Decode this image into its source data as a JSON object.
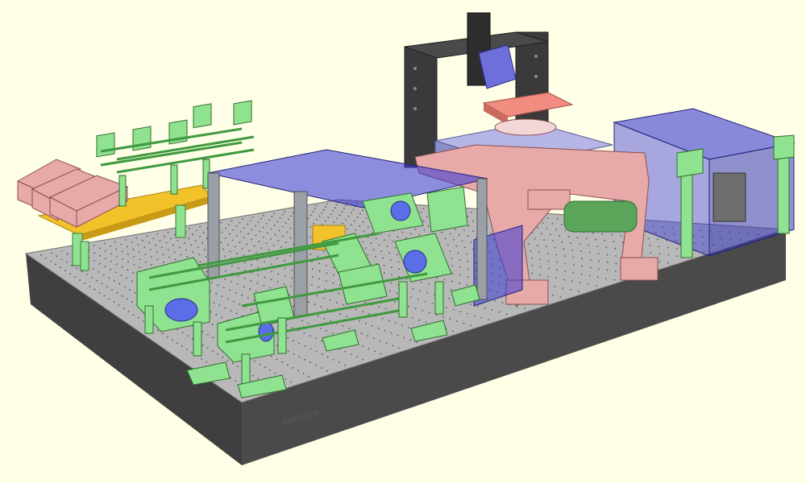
{
  "viewport": {
    "background": "#fffee6"
  },
  "colors": {
    "table_top": "#b4b4b4",
    "table_side": "#474747",
    "table_hole": "#555555",
    "mount_green": "#8fe28f",
    "mount_green_dark": "#4c9a4c",
    "enclosure_blue": "#3b3bd6",
    "enclosure_blue_alpha": "0.55",
    "frame_gray": "#9aa0a6",
    "bracket_dark": "#3a3a3a",
    "pink_part": "#e8a9a9",
    "pink_dark": "#b76f6f",
    "yellow_rail": "#f2c22a",
    "lens_blue": "#5a6ee8",
    "stage_lavender": "#b6b6e6",
    "salmon_plate": "#f08c80"
  },
  "table": {
    "engraving": "@@@@@@"
  },
  "components": [
    {
      "id": "laser-sources",
      "icon": "laser-box-icon"
    },
    {
      "id": "cage-rail-left",
      "icon": "cage-system-icon"
    },
    {
      "id": "enclosure-left",
      "icon": "enclosure-icon"
    },
    {
      "id": "enclosure-right",
      "icon": "enclosure-icon"
    },
    {
      "id": "gantry",
      "icon": "gantry-icon"
    },
    {
      "id": "sample-stage",
      "icon": "stage-icon"
    },
    {
      "id": "cage-rail-front",
      "icon": "cage-system-icon"
    }
  ]
}
